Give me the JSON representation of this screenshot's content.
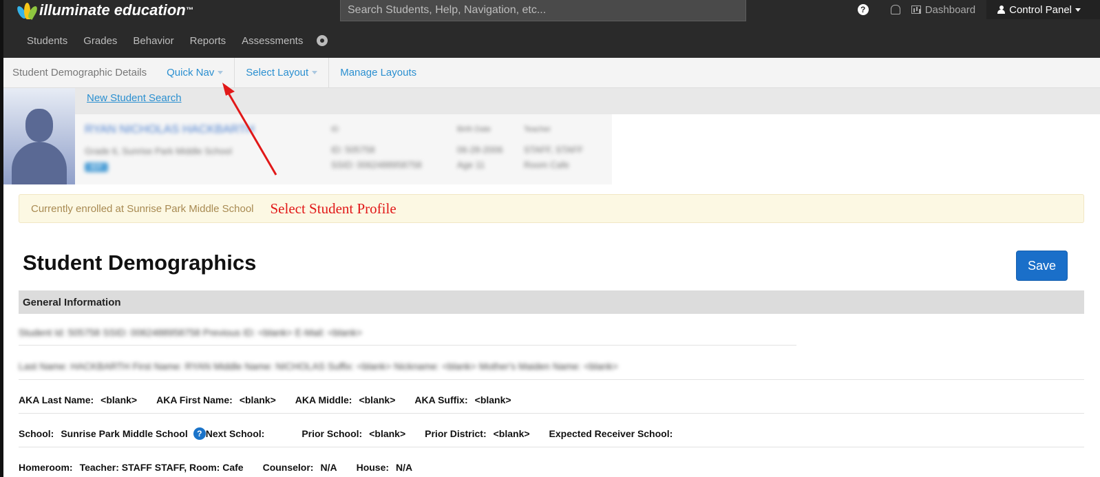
{
  "topbar": {
    "logo_text": "illuminate education",
    "logo_tm": "™",
    "search_placeholder": "Search Students, Help, Navigation, etc...",
    "dashboard_label": "Dashboard",
    "control_panel_label": "Control Panel"
  },
  "mainnav": {
    "items": [
      "Students",
      "Grades",
      "Behavior",
      "Reports",
      "Assessments"
    ]
  },
  "subnav": {
    "crumb": "Student Demographic Details",
    "quick_nav": "Quick Nav",
    "select_layout": "Select Layout",
    "manage_layouts": "Manage Layouts"
  },
  "student": {
    "new_search": "New Student Search",
    "name": "RYAN NICHOLAS HACKBARTH",
    "grade_school": "Grade 6, Sunrise Park Middle School",
    "badge": "IEP",
    "id_label": "ID",
    "id_value": "ID: 505758",
    "ssid_value": "SSID: 0062488958758",
    "birth_label": "Birth Date",
    "birth_value": "06-28-2006",
    "age_value": "Age 11",
    "teacher_label": "Teacher",
    "teacher_value": "STAFF, STAFF",
    "room_value": "Room Cafe"
  },
  "banner": {
    "message": "Currently enrolled at Sunrise Park Middle School",
    "annotation": "Select Student Profile"
  },
  "page": {
    "title": "Student Demographics",
    "save_label": "Save",
    "section_title": "General Information"
  },
  "rows": {
    "row1_blurred": "Student Id:  505758      SSID:  0062488958758      Previous ID:  <blank>      E-Mail:  <blank>",
    "row2_blurred": "Last Name:  HACKBARTH      First Name:  RYAN      Middle Name:  NICHOLAS      Suffix:  <blank>      Nickname:  <blank>      Mother's Maiden Name:  <blank>",
    "aka_last_label": "AKA Last Name:",
    "aka_last_value": "<blank>",
    "aka_first_label": "AKA First Name:",
    "aka_first_value": "<blank>",
    "aka_middle_label": "AKA Middle:",
    "aka_middle_value": "<blank>",
    "aka_suffix_label": "AKA Suffix:",
    "aka_suffix_value": "<blank>",
    "school_label": "School:",
    "school_value": "Sunrise Park Middle School",
    "next_school_label": "Next School:",
    "prior_school_label": "Prior School:",
    "prior_school_value": "<blank>",
    "prior_district_label": "Prior District:",
    "prior_district_value": "<blank>",
    "expected_receiver_label": "Expected Receiver School:",
    "homeroom_label": "Homeroom:",
    "homeroom_value": "Teacher: STAFF STAFF, Room: Cafe",
    "counselor_label": "Counselor:",
    "counselor_value": "N/A",
    "house_label": "House:",
    "house_value": "N/A"
  },
  "colors": {
    "topbar": "#2a2a2a",
    "link": "#2a8fd0",
    "save": "#1a6fc9",
    "annotation": "#e11818"
  }
}
